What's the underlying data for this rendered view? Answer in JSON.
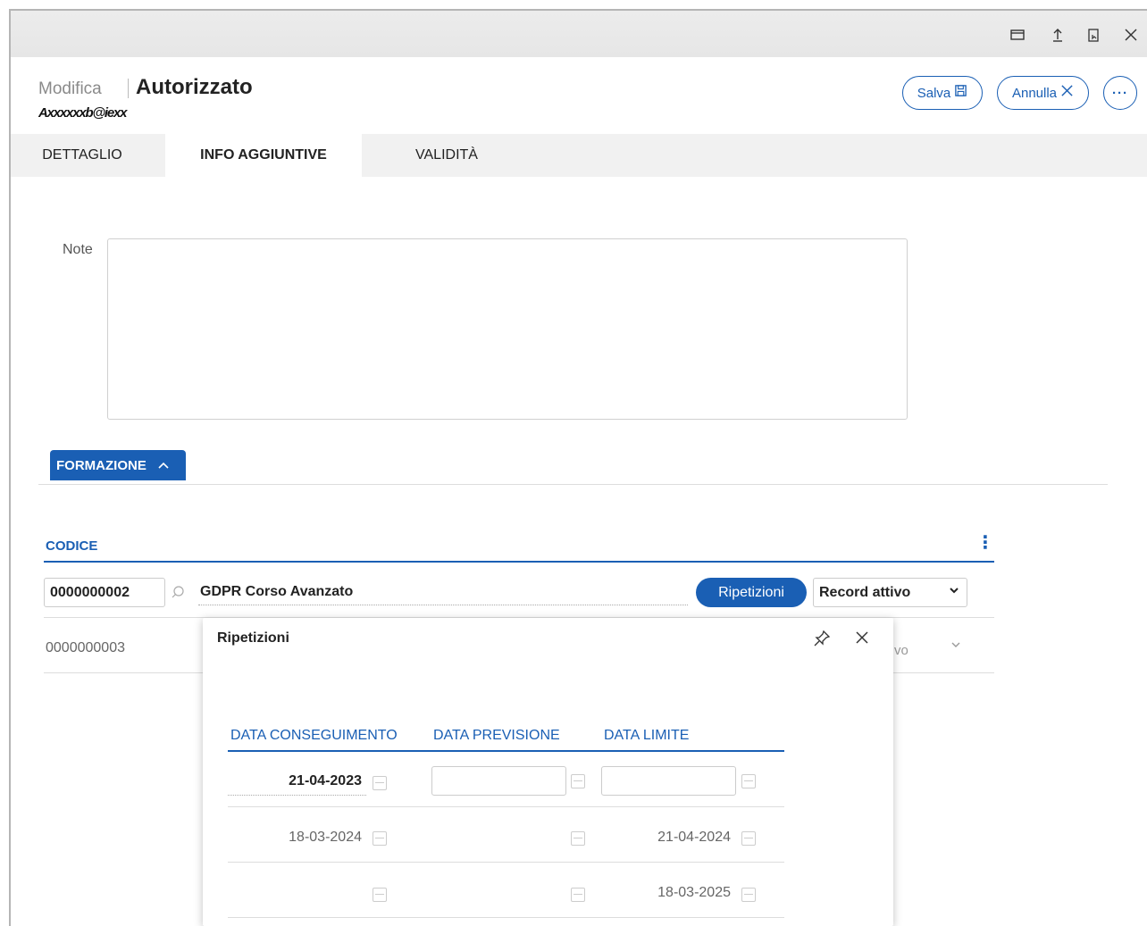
{
  "header": {
    "mode": "Modifica",
    "title": "Autorizzato",
    "user": "Axxxxxxb@iexx",
    "save_label": "Salva",
    "cancel_label": "Annulla",
    "more_label": "···"
  },
  "tabs": [
    "DETTAGLIO",
    "INFO AGGIUNTIVE",
    "VALIDITÀ"
  ],
  "active_tab": "INFO AGGIUNTIVE",
  "note": {
    "label": "Note",
    "value": ""
  },
  "section": {
    "title": "FORMAZIONE"
  },
  "grid": {
    "column": "CODICE",
    "rows": [
      {
        "code": "0000000002",
        "name": "GDPR Corso Avanzato",
        "button": "Ripetizioni",
        "status": "Record attivo"
      },
      {
        "code": "0000000003",
        "partial_status": "vo"
      }
    ]
  },
  "popup": {
    "title": "Ripetizioni",
    "columns": [
      "DATA CONSEGUIMENTO",
      "DATA PREVISIONE",
      "DATA LIMITE"
    ],
    "rows": [
      {
        "conseguimento": "21-04-2023",
        "previsione": "",
        "limite": ""
      },
      {
        "conseguimento": "18-03-2024",
        "previsione": "",
        "limite": "21-04-2024"
      },
      {
        "conseguimento": "",
        "previsione": "",
        "limite": "18-03-2025"
      }
    ]
  },
  "icons": {
    "window": "window-icon",
    "upload": "upload-icon",
    "bookmark": "bookmark-icon",
    "close": "close-icon",
    "save": "save-icon",
    "cancel": "x-icon",
    "search": "search-icon",
    "pin": "pin-icon",
    "calendar": "calendar-icon"
  },
  "colors": {
    "accent": "#1a5fb4",
    "tabbar": "#f1f1f1",
    "topbar": "#e8e8e8"
  }
}
